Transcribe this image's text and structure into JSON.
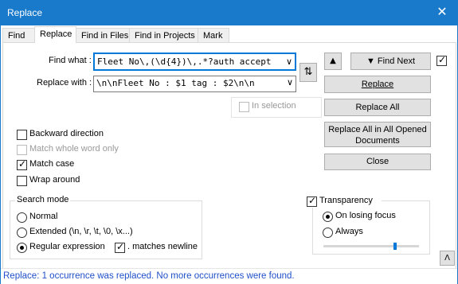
{
  "window": {
    "title": "Replace",
    "close_glyph": "✕"
  },
  "tabs": [
    {
      "label": "Find"
    },
    {
      "label": "Replace"
    },
    {
      "label": "Find in Files"
    },
    {
      "label": "Find in Projects"
    },
    {
      "label": "Mark"
    }
  ],
  "find": {
    "label": "Find what :",
    "value": "Fleet No\\,(\\d{4})\\,.*?auth accept",
    "arrow": "∨"
  },
  "replace": {
    "label": "Replace with :",
    "value": "\\n\\nFleet No : $1 tag : $2\\n\\n",
    "arrow": "∨"
  },
  "swap_glyph": "⇅",
  "buttons": {
    "prev_glyph": "▲",
    "find_next": "▼ Find Next",
    "replace": "Replace",
    "replace_all": "Replace All",
    "replace_all_opened_line1": "Replace All in All Opened",
    "replace_all_opened_line2": "Documents",
    "close": "Close",
    "collapse_glyph": "Λ"
  },
  "options": {
    "in_selection": "In selection",
    "backward": "Backward direction",
    "whole_word": "Match whole word only",
    "match_case": "Match case",
    "wrap_around": "Wrap around"
  },
  "search_mode": {
    "title": "Search mode",
    "normal": "Normal",
    "extended": "Extended (\\n, \\r, \\t, \\0, \\x...)",
    "regex": "Regular expression",
    "dot_newline": ". matches newline"
  },
  "transparency": {
    "title": "Transparency",
    "on_losing_focus": "On losing focus",
    "always": "Always",
    "level": 0.75
  },
  "status": "Replace: 1 occurrence was replaced. No more occurrences were found.",
  "check_glyph": "✓"
}
